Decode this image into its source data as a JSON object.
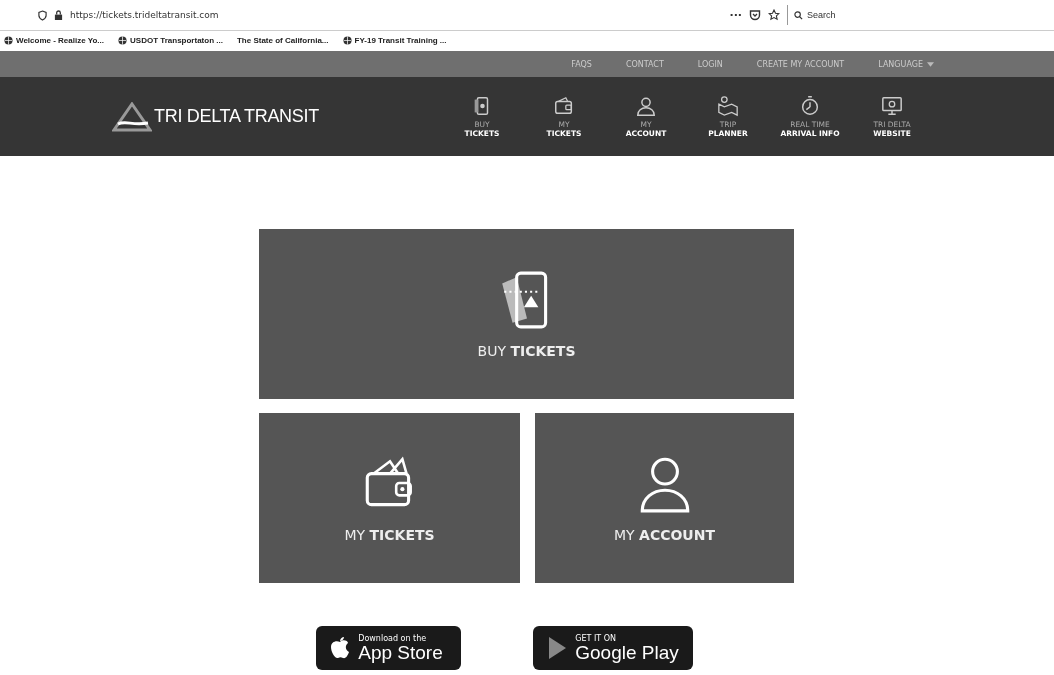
{
  "browser": {
    "url": "https://tickets.trideltatransit.com",
    "search": {
      "placeholder": "Search"
    },
    "menu_glyph": "···",
    "bookmarks": [
      {
        "label": "Welcome - Realize Yo...",
        "icon": true
      },
      {
        "label": "USDOT Transportaton ...",
        "icon": true
      },
      {
        "label": "The State of California...",
        "icon": false
      },
      {
        "label": "FY-19 Transit Training ...",
        "icon": true
      }
    ]
  },
  "top_links": [
    {
      "label": "FAQS",
      "caret": false
    },
    {
      "label": "CONTACT",
      "caret": false
    },
    {
      "label": "LOGIN",
      "caret": false
    },
    {
      "label": "CREATE MY ACCOUNT",
      "caret": false
    },
    {
      "label": "LANGUAGE",
      "caret": true
    }
  ],
  "logo": {
    "text": "TRI DELTA TRANSIT"
  },
  "nav": [
    {
      "kind": "ticket",
      "line1": "BUY",
      "line2": "TICKETS"
    },
    {
      "kind": "wallet",
      "line1": "MY",
      "line2": "TICKETS"
    },
    {
      "kind": "person",
      "line1": "MY",
      "line2": "ACCOUNT"
    },
    {
      "kind": "map",
      "line1": "TRIP",
      "line2": "PLANNER"
    },
    {
      "kind": "clock",
      "line1": "REAL TIME",
      "line2": "ARRIVAL INFO"
    },
    {
      "kind": "monitor",
      "line1": "TRI DELTA",
      "line2": "WEBSITE"
    }
  ],
  "tiles": [
    {
      "kind": "ticket",
      "label": "BUY **TICKETS**"
    },
    {
      "kind": "wallet",
      "label": "MY **TICKETS**"
    },
    {
      "kind": "person",
      "label": "MY **ACCOUNT**"
    }
  ],
  "store_badges": [
    {
      "kind": "apple",
      "small": "Download on the",
      "big": "App Store"
    },
    {
      "kind": "google",
      "small": "GET IT ON",
      "big": "Google Play"
    }
  ]
}
